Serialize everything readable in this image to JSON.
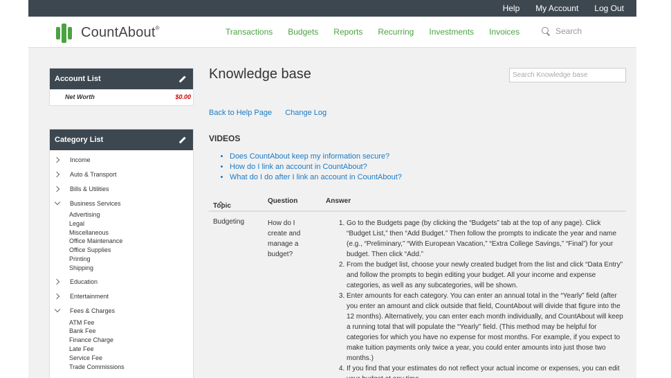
{
  "topbar": {
    "help": "Help",
    "my_account": "My Account",
    "log_out": "Log Out"
  },
  "header": {
    "logo_text": "CountAbout",
    "logo_mark": "®",
    "nav": [
      "Transactions",
      "Budgets",
      "Reports",
      "Recurring",
      "Investments",
      "Invoices"
    ],
    "search_label": "Search"
  },
  "account_list": {
    "title": "Account List",
    "net_worth_label": "Net Worth",
    "net_worth_value": "$0.00"
  },
  "category_list": {
    "title": "Category List",
    "items": [
      {
        "label": "Income",
        "expanded": false,
        "subs": []
      },
      {
        "label": "Auto & Transport",
        "expanded": false,
        "subs": []
      },
      {
        "label": "Bills & Utilities",
        "expanded": false,
        "subs": []
      },
      {
        "label": "Business Services",
        "expanded": true,
        "subs": [
          "Advertising",
          "Legal",
          "Miscellaneous",
          "Office Maintenance",
          "Office Supplies",
          "Printing",
          "Shipping"
        ]
      },
      {
        "label": "Education",
        "expanded": false,
        "subs": []
      },
      {
        "label": "Entertainment",
        "expanded": false,
        "subs": []
      },
      {
        "label": "Fees & Charges",
        "expanded": true,
        "subs": [
          "ATM Fee",
          "Bank Fee",
          "Finance Charge",
          "Late Fee",
          "Service Fee",
          "Trade Commissions"
        ]
      }
    ]
  },
  "kb": {
    "title": "Knowledge base",
    "search_placeholder": "Search Knowledge base",
    "back_link": "Back to Help Page",
    "changelog_link": "Change Log",
    "videos_heading": "VIDEOS",
    "videos": [
      "Does CountAbout keep my information secure?",
      "How do I link an account in CountAbout?",
      "What do I do after I link an account in CountAbout?"
    ],
    "table": {
      "headers": {
        "topic": "Topic",
        "question": "Question",
        "answer": "Answer"
      },
      "row": {
        "topic": "Budgeting",
        "question": "How do I create and manage a budget?",
        "answers": [
          "Go to the Budgets page (by clicking the “Budgets” tab at the top of any page). Click “Budget List,” then “Add Budget.” Then follow the prompts to indicate the year and name (e.g., “Preliminary,” “With European Vacation,” “Extra College Savings,” “Final”) for your budget. Then click “Add.”",
          "From the budget list, choose your newly created budget from the list and click “Data Entry” and follow the prompts to begin editing your budget. All your income and expense categories, as well as any subcategories, will be shown.",
          "Enter amounts for each category. You can enter an annual total in the “Yearly” field (after you enter an amount and click outside that field, CountAbout will divide that figure into the 12 months). Alternatively, you can enter each month individually, and CountAbout will keep a running total that will populate the “Yearly” field. (This method may be helpful for categories for which you have no expense for most months. For example, if you expect to make tuition payments only twice a year, you could enter amounts into just those two months.)",
          "If you find that your estimates do not reflect your actual income or expenses, you can edit your budget at any time."
        ]
      }
    }
  }
}
